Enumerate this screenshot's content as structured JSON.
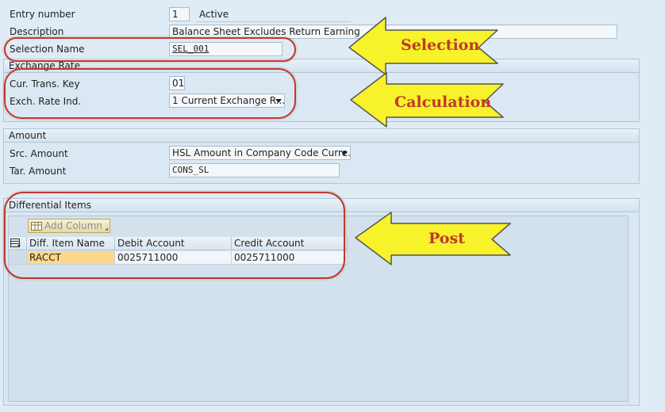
{
  "header": {
    "entry_number_label": "Entry number",
    "entry_number_value": "1",
    "status": "Active",
    "description_label": "Description",
    "description_value": "Balance Sheet Excludes Return Earning",
    "selection_name_label": "Selection Name",
    "selection_name_value": "SEL_001"
  },
  "exchange_rate": {
    "title": "Exchange Rate",
    "cur_trans_key_label": "Cur. Trans. Key",
    "cur_trans_key_value": "01",
    "exch_rate_ind_label": "Exch. Rate Ind.",
    "exch_rate_ind_value": "1 Current Exchange R..."
  },
  "amount": {
    "title": "Amount",
    "src_amount_label": "Src. Amount",
    "src_amount_value": "HSL Amount in Company Code Curre...",
    "tar_amount_label": "Tar. Amount",
    "tar_amount_value": "CONS_SL"
  },
  "differential_items": {
    "title": "Differential Items",
    "add_column_label": "Add Column",
    "columns": [
      "Diff. Item Name",
      "Debit Account",
      "Credit Account"
    ],
    "rows": [
      [
        "RACCT",
        "0025711000",
        "0025711000"
      ]
    ]
  },
  "annotations": {
    "selection": "Selection",
    "calculation": "Calculation",
    "post": "Post"
  },
  "colors": {
    "annotation_red": "#c0392b",
    "arrow_yellow": "#f7f22a",
    "highlight_cell": "#fcd98a"
  }
}
